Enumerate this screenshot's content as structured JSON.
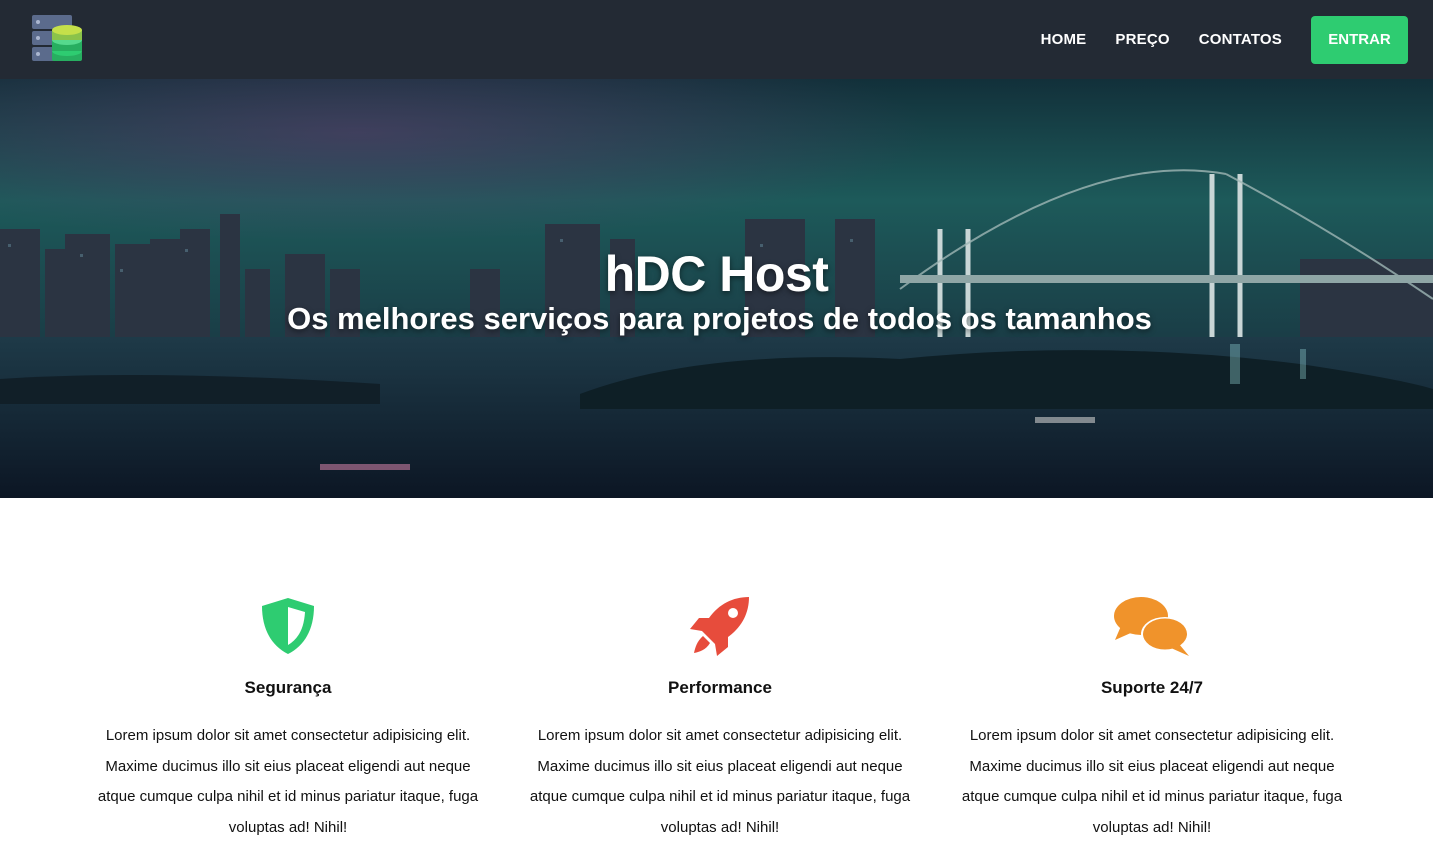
{
  "nav": {
    "logo": "server-database-logo",
    "links": [
      "HOME",
      "PREÇO",
      "CONTATOS"
    ],
    "cta": "ENTRAR"
  },
  "hero": {
    "title": "hDC Host",
    "subtitle": "Os melhores serviços para projetos de todos os tamanhos"
  },
  "features": [
    {
      "icon": "shield-icon",
      "color": "#2ecc71",
      "title": "Segurança",
      "text": "Lorem ipsum dolor sit amet consectetur adipisicing elit. Maxime ducimus illo sit eius placeat eligendi aut neque atque cumque culpa nihil et id minus pariatur itaque, fuga voluptas ad! Nihil!"
    },
    {
      "icon": "rocket-icon",
      "color": "#e74c3c",
      "title": "Performance",
      "text": "Lorem ipsum dolor sit amet consectetur adipisicing elit. Maxime ducimus illo sit eius placeat eligendi aut neque atque cumque culpa nihil et id minus pariatur itaque, fuga voluptas ad! Nihil!"
    },
    {
      "icon": "chat-bubbles-icon",
      "color": "#f0932b",
      "title": "Suporte 24/7",
      "text": "Lorem ipsum dolor sit amet consectetur adipisicing elit. Maxime ducimus illo sit eius placeat eligendi aut neque atque cumque culpa nihil et id minus pariatur itaque, fuga voluptas ad! Nihil!"
    }
  ]
}
